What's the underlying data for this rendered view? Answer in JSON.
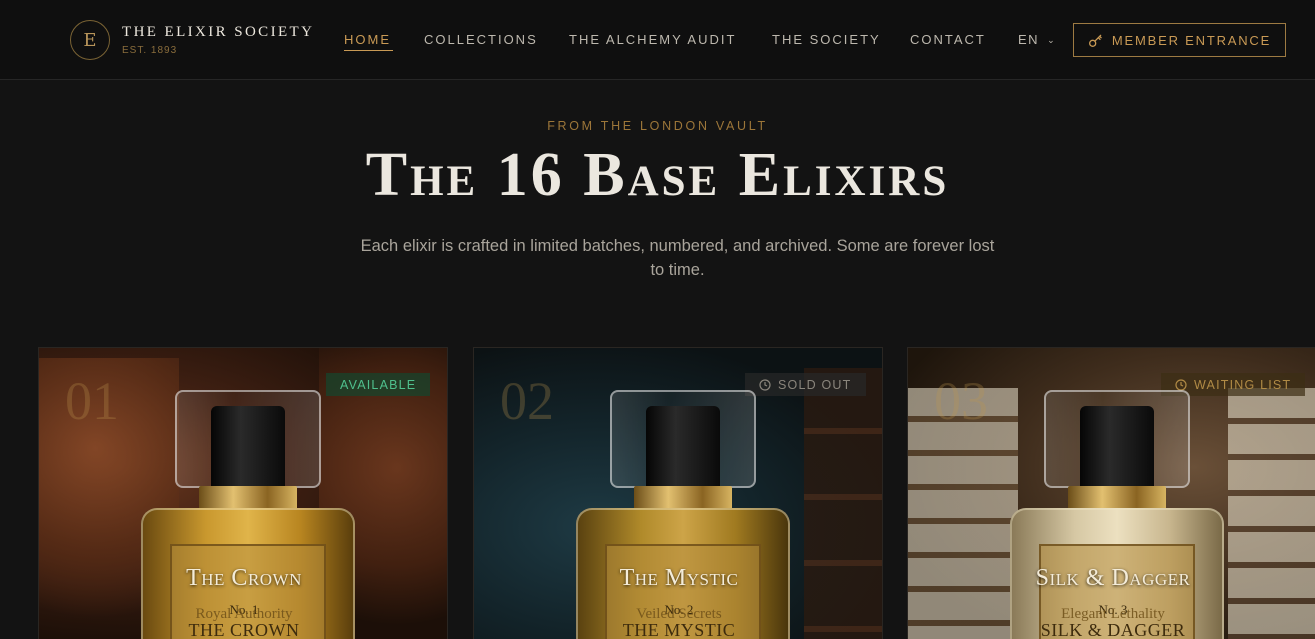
{
  "brand": {
    "monogram": "E",
    "name": "THE ELIXIR SOCIETY",
    "established": "EST. 1893"
  },
  "nav": {
    "items": [
      {
        "label": "HOME",
        "active": true
      },
      {
        "label": "COLLECTIONS",
        "active": false
      },
      {
        "label": "THE ALCHEMY AUDIT",
        "active": false
      },
      {
        "label": "THE SOCIETY",
        "active": false
      },
      {
        "label": "CONTACT",
        "active": false
      }
    ],
    "language": "EN",
    "member_button": "MEMBER ENTRANCE"
  },
  "hero": {
    "eyebrow": "FROM THE LONDON VAULT",
    "title": "The 16 Base Elixirs",
    "subtitle": "Each elixir is crafted in limited batches, numbered, and archived. Some are forever lost to time."
  },
  "cards": [
    {
      "number": "01",
      "status": "AVAILABLE",
      "name": "The Crown",
      "bottle_no": "No. 1",
      "tagline": "Royal Authority",
      "engraving": "THE CROWN"
    },
    {
      "number": "02",
      "status": "SOLD OUT",
      "name": "The Mystic",
      "bottle_no": "No. 2",
      "tagline": "Veiled Secrets",
      "engraving": "THE MYSTIC"
    },
    {
      "number": "03",
      "status": "WAITING LIST",
      "name": "Silk & Dagger",
      "bottle_no": "No. 3",
      "tagline": "Elegant Lethality",
      "engraving": "SILK & DAGGER"
    }
  ],
  "colors": {
    "background": "#131313",
    "header": "#0f0f0f",
    "gold_accent": "#c99a55",
    "available": "#4fc08d",
    "muted_badge": "#8a857c"
  }
}
